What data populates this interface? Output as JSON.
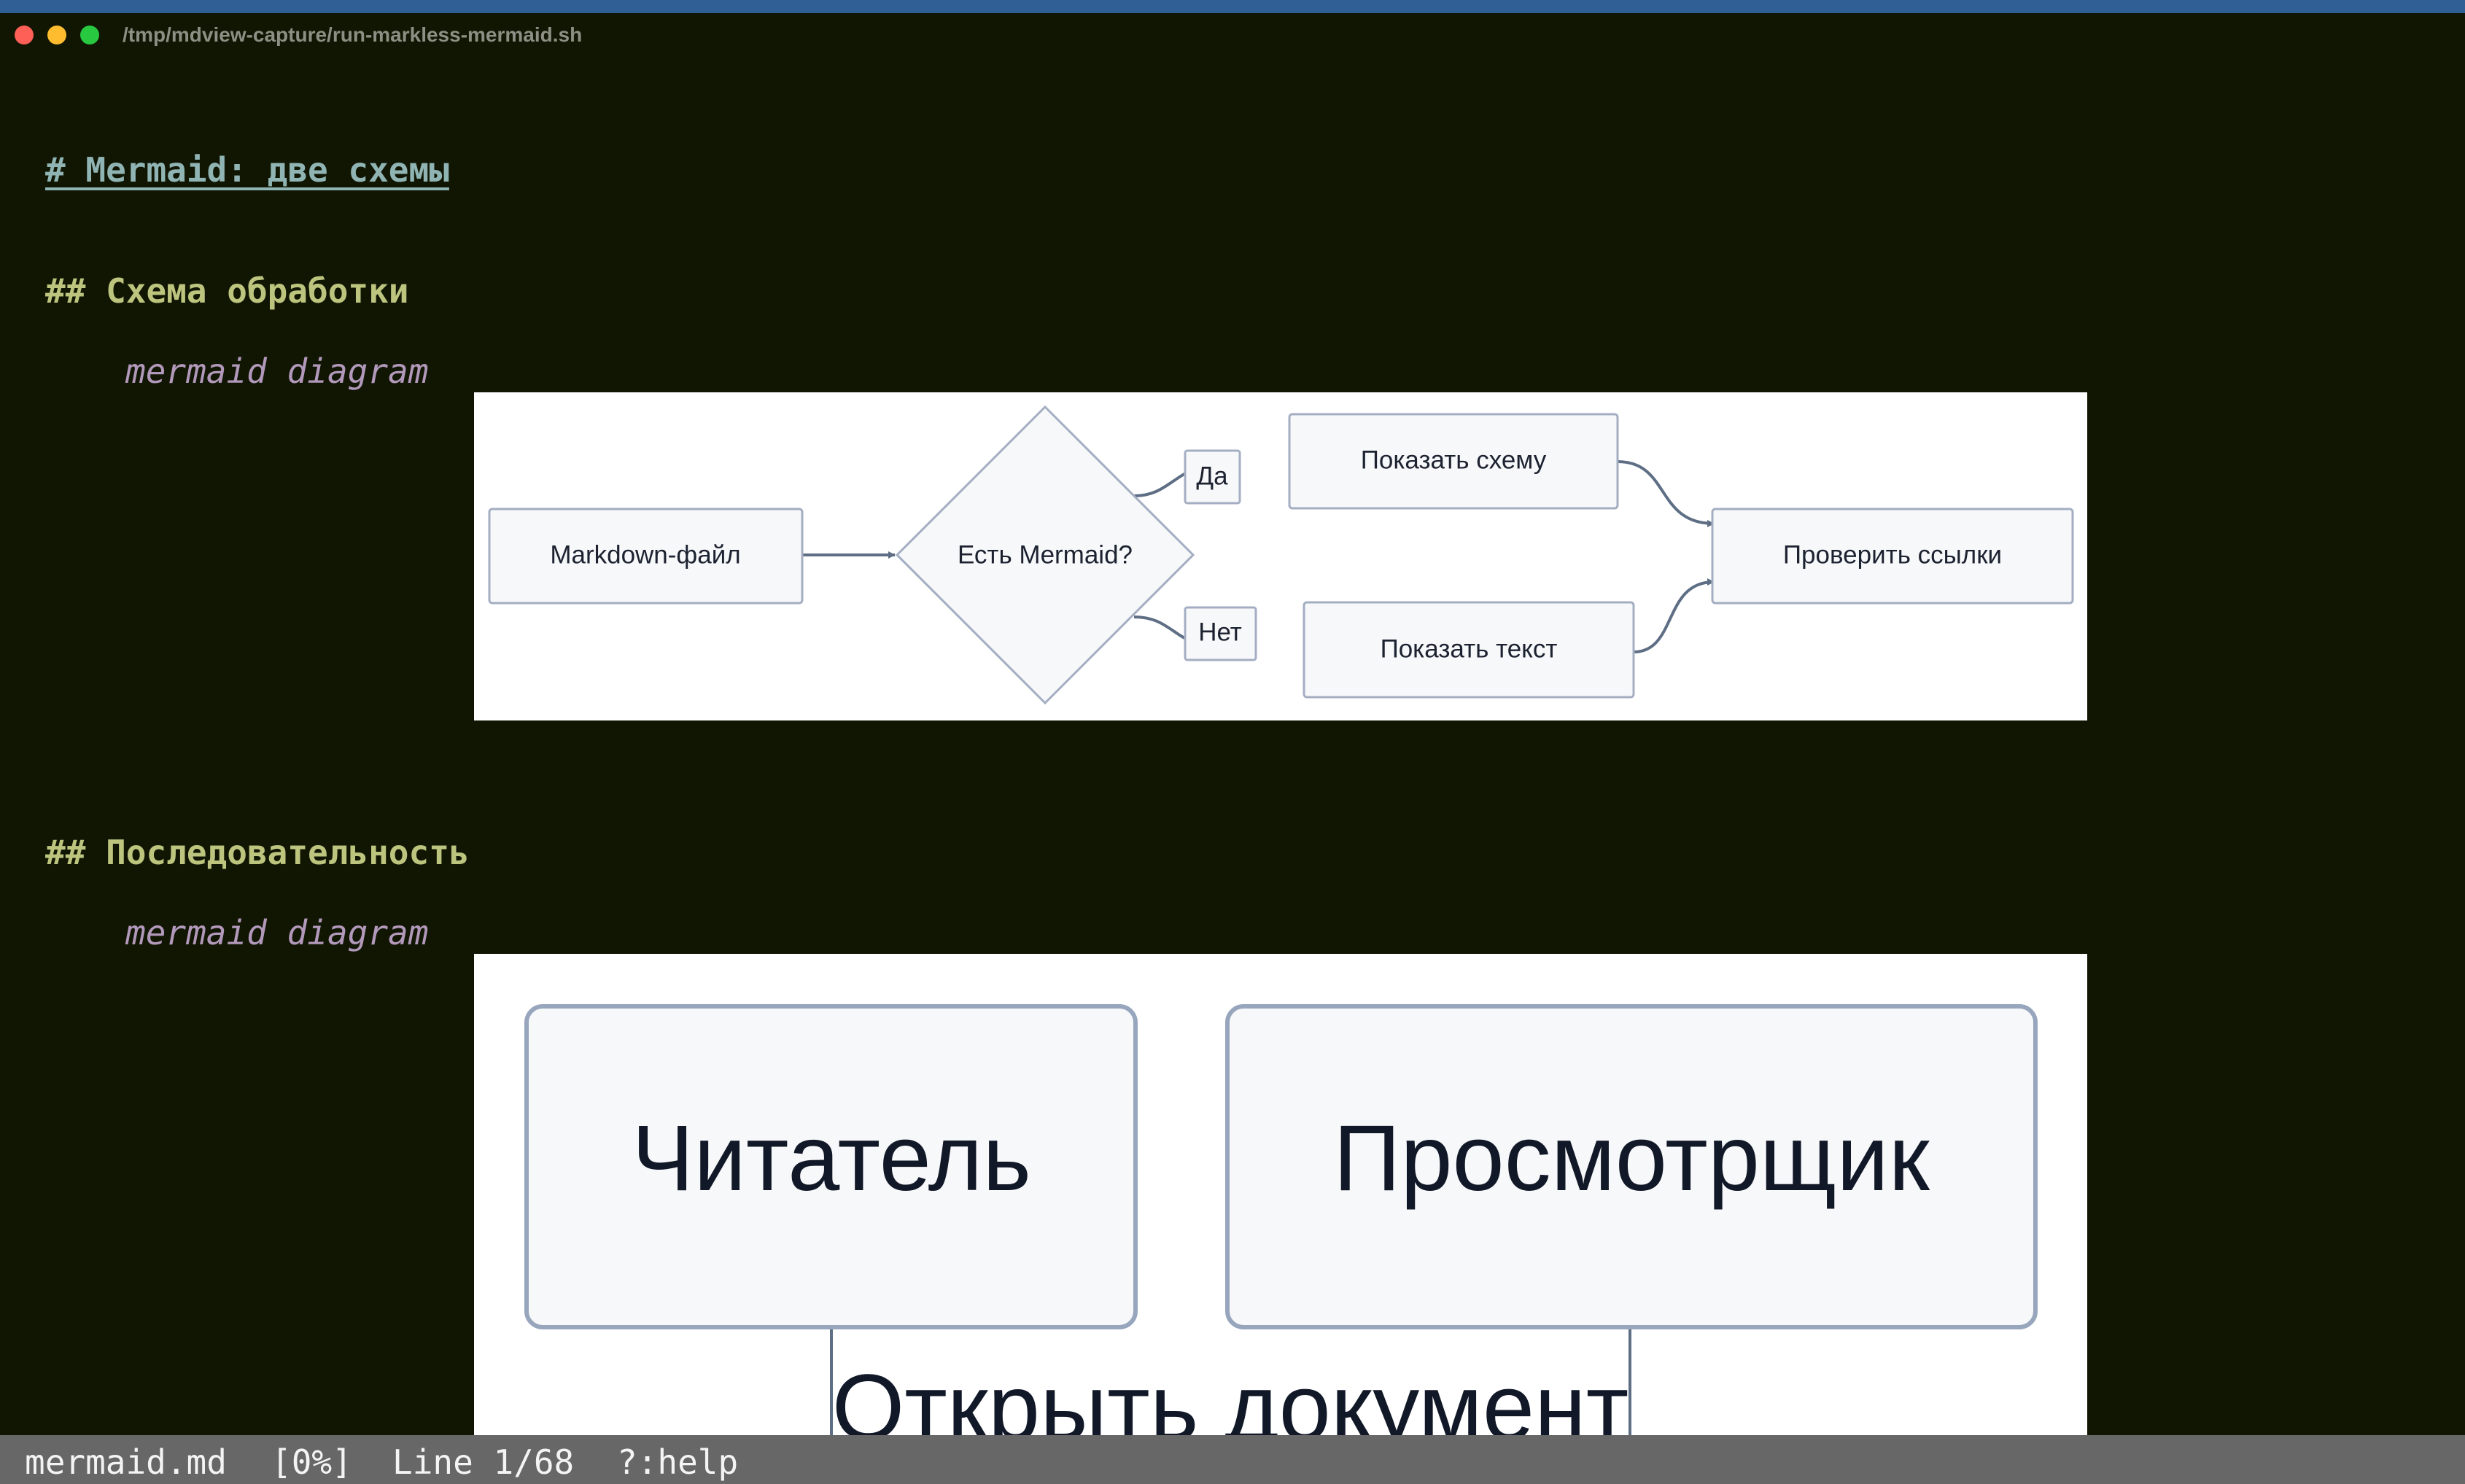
{
  "window": {
    "title": "/tmp/mdview-capture/run-markless-mermaid.sh"
  },
  "document": {
    "h1": "# Mermaid: две схемы",
    "section1": {
      "heading": "## Схема обработки",
      "caption": "mermaid diagram"
    },
    "section2": {
      "heading": "## Последовательность",
      "caption": "mermaid diagram"
    }
  },
  "flowchart": {
    "nodes": {
      "markdown": "Markdown-файл",
      "decision": "Есть Mermaid?",
      "show_diagram": "Показать схему",
      "show_text": "Показать текст",
      "check_links": "Проверить ссылки"
    },
    "edge_labels": {
      "yes": "Да",
      "no": "Нет"
    }
  },
  "sequence": {
    "participants": [
      "Читатель",
      "Просмотрщик"
    ],
    "message": "Открыть документ"
  },
  "statusbar": {
    "filename": "mermaid.md",
    "percent": "[0%]",
    "line": "Line 1/68",
    "help": "?:help"
  },
  "colors": {
    "background": "#111603",
    "heading1": "#8fb4b3",
    "heading2": "#bcc47e",
    "caption": "#b299bb",
    "statusbar": "#676767",
    "diagram_stroke": "#5e6e84"
  }
}
